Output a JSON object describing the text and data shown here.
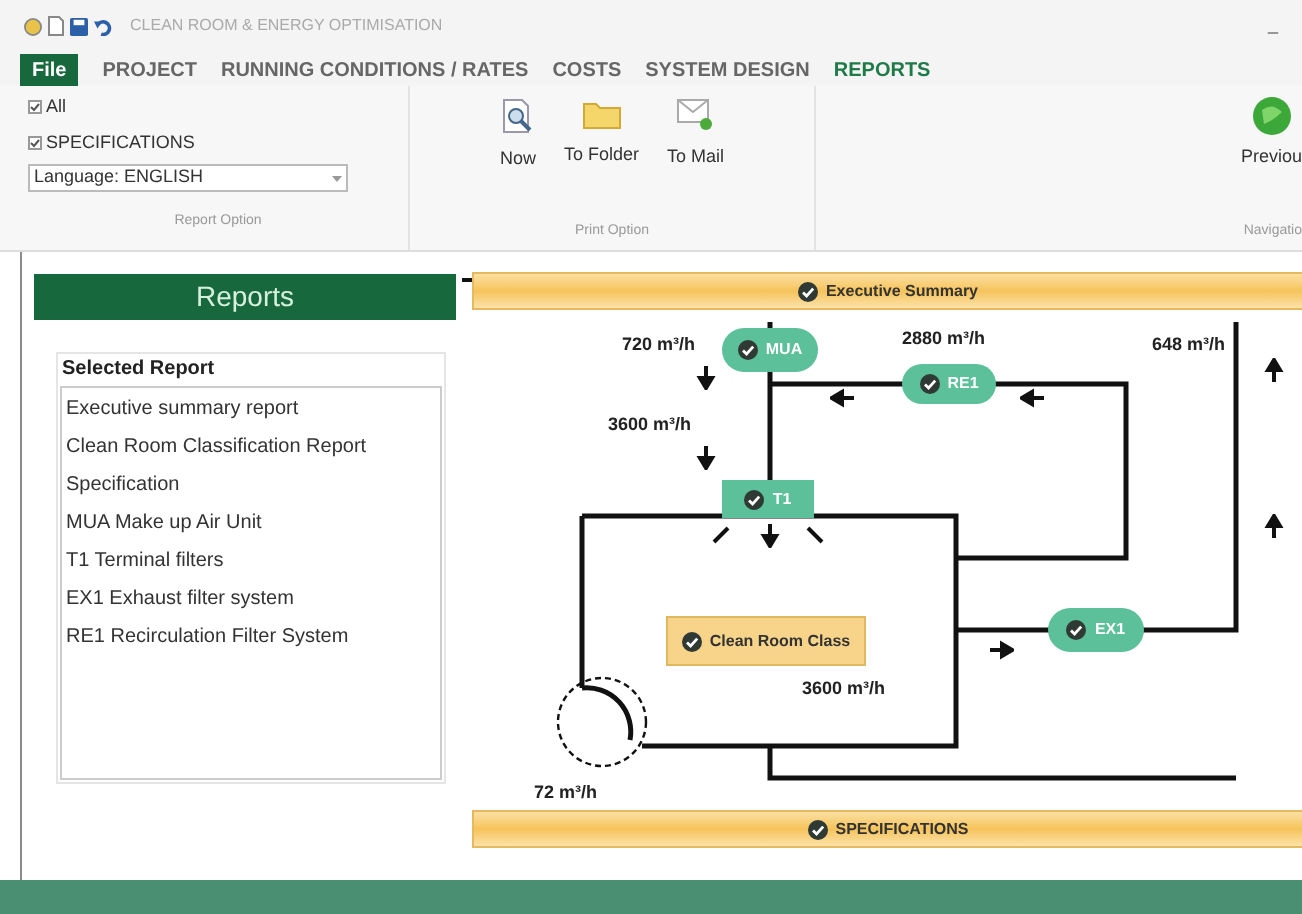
{
  "window": {
    "title": "CLEAN ROOM & ENERGY OPTIMISATION",
    "minimize": "_"
  },
  "ribbon_tabs": [
    {
      "label": "File",
      "kind": "file",
      "selected": false
    },
    {
      "label": "PROJECT",
      "kind": "tab",
      "selected": false
    },
    {
      "label": "RUNNING CONDITIONS / RATES",
      "kind": "tab",
      "selected": false
    },
    {
      "label": "COSTS",
      "kind": "tab",
      "selected": false
    },
    {
      "label": "SYSTEM DESIGN",
      "kind": "tab",
      "selected": false
    },
    {
      "label": "REPORTS",
      "kind": "tab",
      "selected": true
    }
  ],
  "report_option": {
    "checkboxes": [
      {
        "label": "All",
        "checked": true
      },
      {
        "label": "SPECIFICATIONS",
        "checked": true
      }
    ],
    "language": "Language: ENGLISH",
    "group_label": "Report Option"
  },
  "print_option": {
    "buttons": [
      "Now",
      "To Folder",
      "To Mail"
    ],
    "group_label": "Print Option"
  },
  "navigation": {
    "button": "Previou",
    "group_label": "Navigatio"
  },
  "reports_panel": {
    "title": "Reports",
    "group_title": "Selected Report",
    "items": [
      "Executive summary report",
      "Clean Room Classification Report",
      "Specification",
      "MUA Make up Air Unit",
      "T1 Terminal filters",
      "EX1 Exhaust filter system",
      "RE1 Recirculation Filter System"
    ]
  },
  "diagram": {
    "header": "Executive Summary",
    "footer": "SPECIFICATIONS",
    "nodes": [
      {
        "label": "MUA",
        "kind": "pill"
      },
      {
        "label": "RE1",
        "kind": "pill"
      },
      {
        "label": "T1",
        "kind": "block"
      },
      {
        "label": "EX1",
        "kind": "pill"
      },
      {
        "label": "Clean Room Class",
        "kind": "room"
      }
    ],
    "flows": [
      "720 m³/h",
      "2880 m³/h",
      "648 m³/h",
      "3600 m³/h",
      "3600 m³/h",
      "72 m³/h"
    ]
  }
}
